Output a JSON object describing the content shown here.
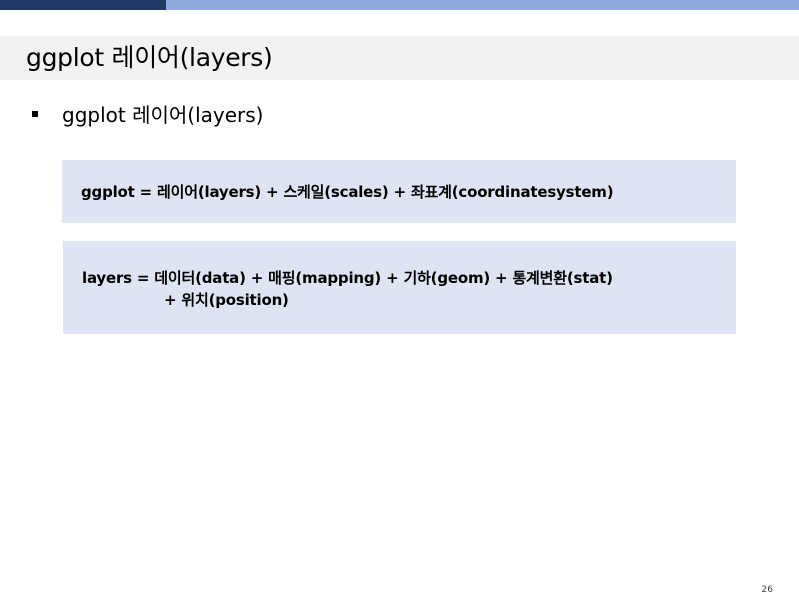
{
  "slide": {
    "title": "ggplot 레이어(layers)",
    "bullet": "ggplot 레이어(layers)",
    "formula_ggplot": "ggplot = 레이어(layers) + 스케일(scales) + 좌표계(coordinatesystem)",
    "formula_layers_line1": "layers = 데이터(data) + 매핑(mapping) + 기하(geom) + 통계변환(stat)",
    "formula_layers_line2": "+ 위치(position)",
    "page_number": "26"
  },
  "colors": {
    "top_bar_dark": "#1f3864",
    "top_bar_light": "#8faadc",
    "title_band": "#f2f2f2",
    "box_fill": "#dee4f1"
  }
}
